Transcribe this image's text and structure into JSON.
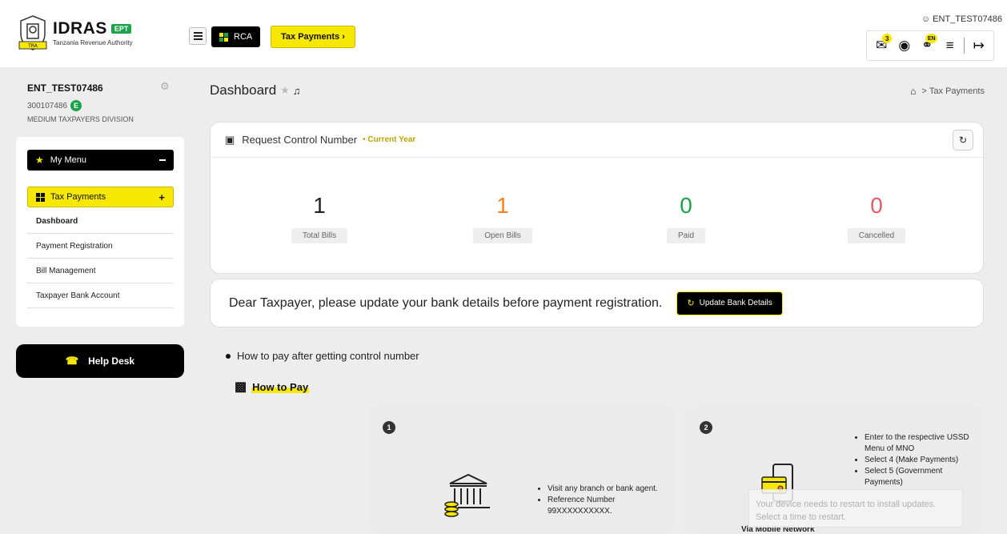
{
  "header": {
    "logo_title": "IDRAS",
    "logo_badge": "EPT",
    "logo_subtitle": "Tanzania Revenue Authority",
    "logo_seal_text": "TRA",
    "rca_label": "RCA",
    "tax_payments_label": "Tax Payments ›",
    "user_label": "ENT_TEST07486",
    "mail_count": "3",
    "lang_badge": "EN"
  },
  "sidebar": {
    "user_name": "ENT_TEST07486",
    "tin": "300107486",
    "tin_badge": "E",
    "division": "MEDIUM TAXPAYERS DIVISION",
    "my_menu_label": "My Menu",
    "tax_payments_label": "Tax Payments",
    "submenu": [
      {
        "label": "Dashboard",
        "active": true
      },
      {
        "label": "Payment Registration",
        "active": false
      },
      {
        "label": "Bill Management",
        "active": false
      },
      {
        "label": "Taxpayer Bank Account",
        "active": false
      }
    ],
    "help_desk_label": "Help Desk"
  },
  "main": {
    "page_title": "Dashboard",
    "breadcrumb_current": "Tax Payments",
    "rcn": {
      "title": "Request Control Number",
      "period": "• Current Year",
      "stats": [
        {
          "value": "1",
          "label": "Total Bills",
          "color": "#222222"
        },
        {
          "value": "1",
          "label": "Open Bills",
          "color": "#f5821f"
        },
        {
          "value": "0",
          "label": "Paid",
          "color": "#1ba34a"
        },
        {
          "value": "0",
          "label": "Cancelled",
          "color": "#e65a6a"
        }
      ]
    },
    "bank_notice": {
      "message": "Dear Taxpayer, please update your bank details before payment registration.",
      "button_label": "Update Bank Details"
    },
    "how_to_bullet": "How to pay after getting control number",
    "how_to_title": "How to Pay",
    "steps": [
      {
        "num": "1",
        "items": [
          "Visit any branch or bank agent.",
          "Reference Number 99XXXXXXXXXX."
        ]
      },
      {
        "num": "2",
        "items": [
          "Enter to the respective USSD Menu of MNO",
          "Select 4 (Make Payments)",
          "Select 5 (Government Payments)"
        ],
        "caption": "Via Mobile Network"
      }
    ]
  },
  "toast": {
    "line1": "Your device needs to restart to install updates.",
    "line2": "Select a time to restart."
  },
  "colors": {
    "brand_yellow": "#f6e800",
    "brand_black": "#000000",
    "green": "#1ba34a"
  }
}
